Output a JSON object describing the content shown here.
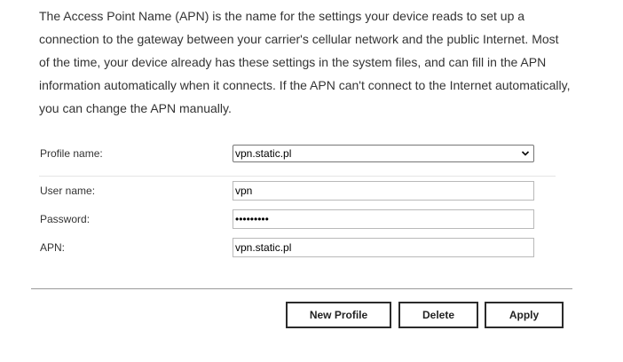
{
  "intro": {
    "line1": "The Access Point Name (APN) is the name for the settings your device reads to set up a",
    "line2": "connection to the gateway between your carrier's cellular network and the public Internet. Most",
    "line3": "of the time, your device already has these settings in the system files, and can fill in the APN",
    "line4": "information automatically when it connects. If the APN can't connect to the Internet automatically,",
    "line5": "you can change the APN manually."
  },
  "form": {
    "profile_label": "Profile name:",
    "profile_value": "vpn.static.pl",
    "username_label": "User name:",
    "username_value": "vpn",
    "password_label": "Password:",
    "password_value": "•••••••••",
    "apn_label": "APN:",
    "apn_value": "vpn.static.pl"
  },
  "buttons": {
    "new_profile": "New Profile",
    "delete": "Delete",
    "apply": "Apply"
  },
  "icons": {
    "dropdown": "chevron-down-icon"
  }
}
